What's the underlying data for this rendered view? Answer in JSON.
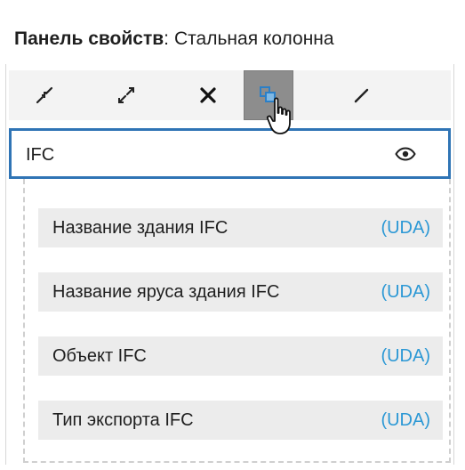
{
  "panel": {
    "title_label": "Панель свойств",
    "title_separator": ":",
    "object_name": "Стальная колонна"
  },
  "toolbar": {
    "buttons": [
      {
        "name": "collapse-icon",
        "active": false
      },
      {
        "name": "expand-icon",
        "active": false
      },
      {
        "name": "close-icon",
        "active": false
      },
      {
        "name": "copy-icon",
        "active": true
      },
      {
        "name": "edit-icon",
        "active": false
      }
    ]
  },
  "section": {
    "title": "IFC",
    "visibility_icon": "eye-icon"
  },
  "properties": [
    {
      "name": "Название здания IFC",
      "tag": "(UDA)"
    },
    {
      "name": "Название яруса здания IFC",
      "tag": "(UDA)"
    },
    {
      "name": "Объект IFC",
      "tag": "(UDA)"
    },
    {
      "name": "Тип экспорта IFC",
      "tag": "(UDA)"
    }
  ],
  "colors": {
    "selection_border": "#2f74b5",
    "uda_tag": "#2b98d5",
    "row_background": "#ececec",
    "toolbar_background": "#f3f3f3"
  }
}
